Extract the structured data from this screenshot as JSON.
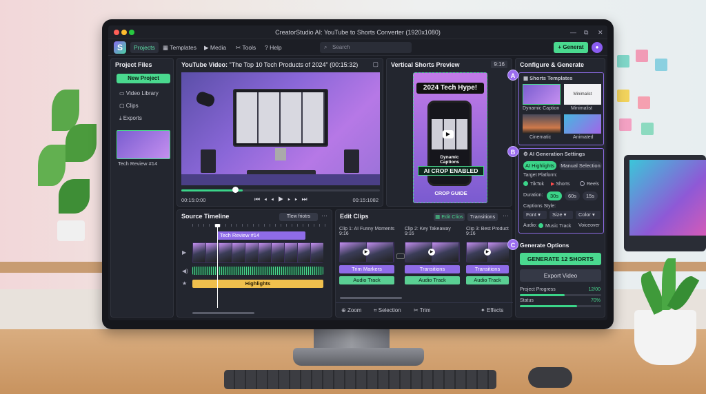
{
  "window": {
    "title": "CreatorStudio AI: YouTube to Shorts Converter (1920x1080)",
    "controls": [
      "✕",
      "⧉",
      "✕"
    ]
  },
  "menu": {
    "logo": "S",
    "tabs": [
      {
        "label": "Projects",
        "icon": "folder-icon"
      },
      {
        "label": "Templates",
        "icon": "grid-icon"
      },
      {
        "label": "Media",
        "icon": "play-icon"
      },
      {
        "label": "Tools",
        "icon": "tools-icon"
      },
      {
        "label": "Help",
        "icon": "help-icon"
      }
    ],
    "search_placeholder": "Search",
    "generate_label": "Generat"
  },
  "project_files": {
    "title": "Project Files",
    "new_project": "New Project",
    "items": [
      "Video Library",
      "Clips",
      "Exports"
    ],
    "thumb_label": "Tech Review #14"
  },
  "video": {
    "title_prefix": "YouTube Video:",
    "title_value": "\"The Top 10 Tech Products of 2024\" (00:15:32)",
    "time_left": "00:15:0:00",
    "time_right": "00:15:1082",
    "progress": 0.31
  },
  "shorts_preview": {
    "title": "Vertical Shorts Preview",
    "ratio": "9:16",
    "headline": "2024 Tech Hype!",
    "caption": "Dynamic Captions",
    "crop_banner": "AI CROP ENABLED",
    "crop_guide": "CROP GUIDE"
  },
  "timeline": {
    "title": "Source Timeline",
    "view_btn": "Tlew friotrs",
    "clip_label": "Tech Review #14",
    "highlights": "Highlights"
  },
  "edit_clips": {
    "title": "Edit Clips",
    "edit_btn": "Edit Clios",
    "transitions_btn": "Transitions",
    "clips": [
      {
        "name": "Clip 1: AI Funny Moments",
        "ratio": "9:16",
        "b1": "Trim Markers",
        "b2": "Audio Track"
      },
      {
        "name": "Clip 2: Key Takeaway",
        "ratio": "9:16",
        "b1": "Transitions",
        "b2": "Audio Track"
      },
      {
        "name": "Clip 3: Best Product",
        "ratio": "9:16",
        "b1": "Transitions",
        "b2": "Audio Track"
      }
    ],
    "tools": [
      "Zoom",
      "Selection",
      "Trim",
      "Effects"
    ]
  },
  "configure": {
    "title": "Configure & Generate",
    "markers": [
      "A",
      "B",
      "C"
    ],
    "templates_title": "Shorts Templates",
    "templates": [
      "Dynamic Caption",
      "Minimalist",
      "Cinematic",
      "Animated"
    ],
    "minimalist_thumb": "Minimalist",
    "ai_title": "AI Generation Settings",
    "mode_on": "AI Highlights",
    "mode_off": "Manual Selection",
    "platform_label": "Target Platform:",
    "platforms": [
      "TikTok",
      "Shorts",
      "Reels"
    ],
    "duration_label": "Duration:",
    "durations": [
      "30s",
      "60s",
      "15s"
    ],
    "captions_label": "Captions Style:",
    "caption_opts": [
      "Font",
      "Size",
      "Color"
    ],
    "audio_label": "Audio:",
    "audio_opts": [
      "Music Track",
      "Voiceover"
    ],
    "gen_title": "Generate Options",
    "generate_btn": "GENERATE 12 SHORTS",
    "export_btn": "Export Video",
    "progress_label": "Project Progress",
    "progress_value": "12/00",
    "progress_fraction": 0.55,
    "status_label": "Status",
    "status_value": "70%",
    "status_fraction": 0.7
  },
  "colors": {
    "accent_green": "#4ad98f",
    "accent_purple": "#8f6ce8"
  }
}
